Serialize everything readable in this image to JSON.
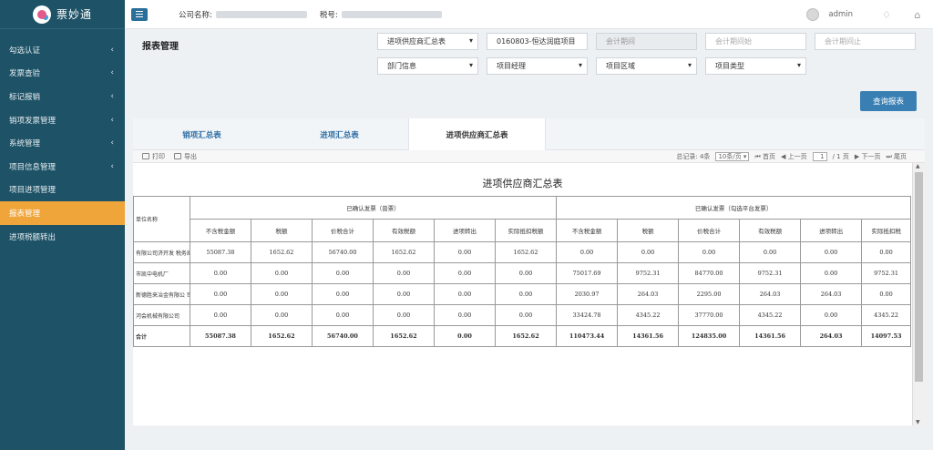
{
  "app": {
    "name": "票妙通"
  },
  "sidebar": {
    "items": [
      {
        "label": "勾选认证",
        "chevron": "‹"
      },
      {
        "label": "发票查验",
        "chevron": "‹"
      },
      {
        "label": "标记报销",
        "chevron": "‹"
      },
      {
        "label": "销项发票管理",
        "chevron": "‹"
      },
      {
        "label": "系统管理",
        "chevron": "‹"
      },
      {
        "label": "项目信息管理",
        "chevron": "‹"
      },
      {
        "label": "项目进项管理",
        "chevron": ""
      },
      {
        "label": "报表管理",
        "chevron": ""
      },
      {
        "label": "进项税额转出",
        "chevron": ""
      }
    ],
    "active_index": 7
  },
  "topbar": {
    "company_label": "公司名称:",
    "tax_label": "税号:",
    "user": "admin"
  },
  "page": {
    "title": "报表管理"
  },
  "filters": {
    "report_type": "进项供应商汇总表",
    "project": "0160803-恒达润庭项目",
    "period": "会计期间",
    "period_start": "会计期间始",
    "period_end": "会计期间止",
    "dept": "部门信息",
    "manager": "项目经理",
    "region": "项目区域",
    "project_type": "项目类型"
  },
  "query_button": "查询报表",
  "tabs": [
    "销项汇总表",
    "进项汇总表",
    "进项供应商汇总表"
  ],
  "active_tab": 2,
  "toolbar": {
    "print": "打印",
    "export": "导出",
    "total_records": "总记录: 4条",
    "page_size": "10条/页",
    "first": "首页",
    "prev": "上一页",
    "page": "1",
    "of_pages": "/ 1 页",
    "next": "下一页",
    "last": "尾页"
  },
  "report": {
    "title": "进项供应商汇总表",
    "unit_header": "单位名称",
    "group1": "已确认发票（普票）",
    "group2": "已确认发票（勾选平台发票）",
    "columns": [
      "不含税金额",
      "税额",
      "价税合计",
      "有效税额",
      "进项转出",
      "实际抵扣税额",
      "不含税金额",
      "税额",
      "价税合计",
      "有效税额",
      "进项转出",
      "实际抵扣税"
    ],
    "rows": [
      {
        "name": "有限公司济开发 税务局（9）",
        "values": [
          "55087.38",
          "1652.62",
          "56740.00",
          "1652.62",
          "0.00",
          "1652.62",
          "0.00",
          "0.00",
          "0.00",
          "0.00",
          "0.00",
          "0.00"
        ]
      },
      {
        "name": "市凯中电机厂",
        "values": [
          "0.00",
          "0.00",
          "0.00",
          "0.00",
          "0.00",
          "0.00",
          "75017.69",
          "9752.31",
          "84770.00",
          "9752.31",
          "0.00",
          "9752.31"
        ]
      },
      {
        "name": "新德胜来冶金有限公 司",
        "values": [
          "0.00",
          "0.00",
          "0.00",
          "0.00",
          "0.00",
          "0.00",
          "2030.97",
          "264.03",
          "2295.00",
          "264.03",
          "264.03",
          "0.00"
        ]
      },
      {
        "name": "河会机械有限公司",
        "values": [
          "0.00",
          "0.00",
          "0.00",
          "0.00",
          "0.00",
          "0.00",
          "33424.78",
          "4345.22",
          "37770.00",
          "4345.22",
          "0.00",
          "4345.22"
        ]
      }
    ],
    "total": {
      "name": "合计",
      "values": [
        "55087.38",
        "1652.62",
        "56740.00",
        "1652.62",
        "0.00",
        "1652.62",
        "110473.44",
        "14361.56",
        "124835.00",
        "14361.56",
        "264.03",
        "14097.53"
      ]
    }
  }
}
